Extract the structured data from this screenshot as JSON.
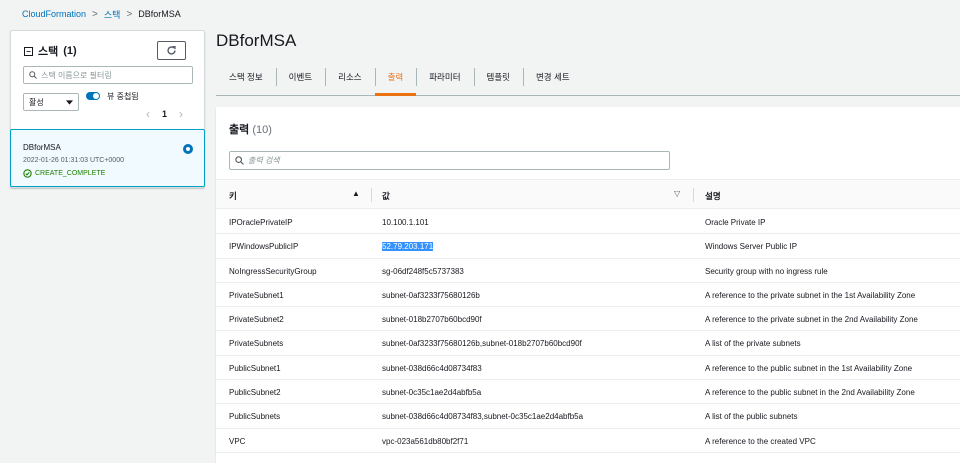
{
  "breadcrumb": {
    "root": "CloudFormation",
    "sep": ">",
    "level2": "스택",
    "current": "DBforMSA"
  },
  "left_panel": {
    "title": "스택",
    "count": "(1)",
    "search_placeholder": "스택 이름으로 필터링",
    "status_filter": "활성",
    "toggle_label": "뷰 중첩됨",
    "page": "1",
    "stack": {
      "name": "DBforMSA",
      "time": "2022-01-26 01:31:03 UTC+0000",
      "status": "CREATE_COMPLETE"
    }
  },
  "page_title": "DBforMSA",
  "tabs": [
    {
      "label": "스택 정보"
    },
    {
      "label": "이벤트"
    },
    {
      "label": "리소스"
    },
    {
      "label": "출력"
    },
    {
      "label": "파라미터"
    },
    {
      "label": "템플릿"
    },
    {
      "label": "변경 세트"
    }
  ],
  "active_tab": "출력",
  "outputs": {
    "title": "출력",
    "count": "(10)",
    "search_placeholder": "출력 검색",
    "columns": {
      "key": "키",
      "value": "값",
      "description": "설명"
    },
    "rows": [
      {
        "key": "IPOraclePrivateIP",
        "value": "10.100.1.101",
        "description": "Oracle Private IP"
      },
      {
        "key": "IPWindowsPublicIP",
        "value": "52.79.203.171",
        "description": "Windows Server Public IP"
      },
      {
        "key": "NoIngressSecurityGroup",
        "value": "sg-06df248f5c5737383",
        "description": "Security group with no ingress rule"
      },
      {
        "key": "PrivateSubnet1",
        "value": "subnet-0af3233f75680126b",
        "description": "A reference to the private subnet in the 1st Availability Zone"
      },
      {
        "key": "PrivateSubnet2",
        "value": "subnet-018b2707b60bcd90f",
        "description": "A reference to the private subnet in the 2nd Availability Zone"
      },
      {
        "key": "PrivateSubnets",
        "value": "subnet-0af3233f75680126b,subnet-018b2707b60bcd90f",
        "description": "A list of the private subnets"
      },
      {
        "key": "PublicSubnet1",
        "value": "subnet-038d66c4d08734f83",
        "description": "A reference to the public subnet in the 1st Availability Zone"
      },
      {
        "key": "PublicSubnet2",
        "value": "subnet-0c35c1ae2d4abfb5a",
        "description": "A reference to the public subnet in the 2nd Availability Zone"
      },
      {
        "key": "PublicSubnets",
        "value": "subnet-038d66c4d08734f83,subnet-0c35c1ae2d4abfb5a",
        "description": "A list of the public subnets"
      },
      {
        "key": "VPC",
        "value": "vpc-023a561db80bf2f71",
        "description": "A reference to the created VPC"
      }
    ]
  },
  "colors": {
    "link": "#0073bb",
    "active_tab": "#ec7211",
    "success": "#1d8102",
    "selection": "#3392ff"
  }
}
